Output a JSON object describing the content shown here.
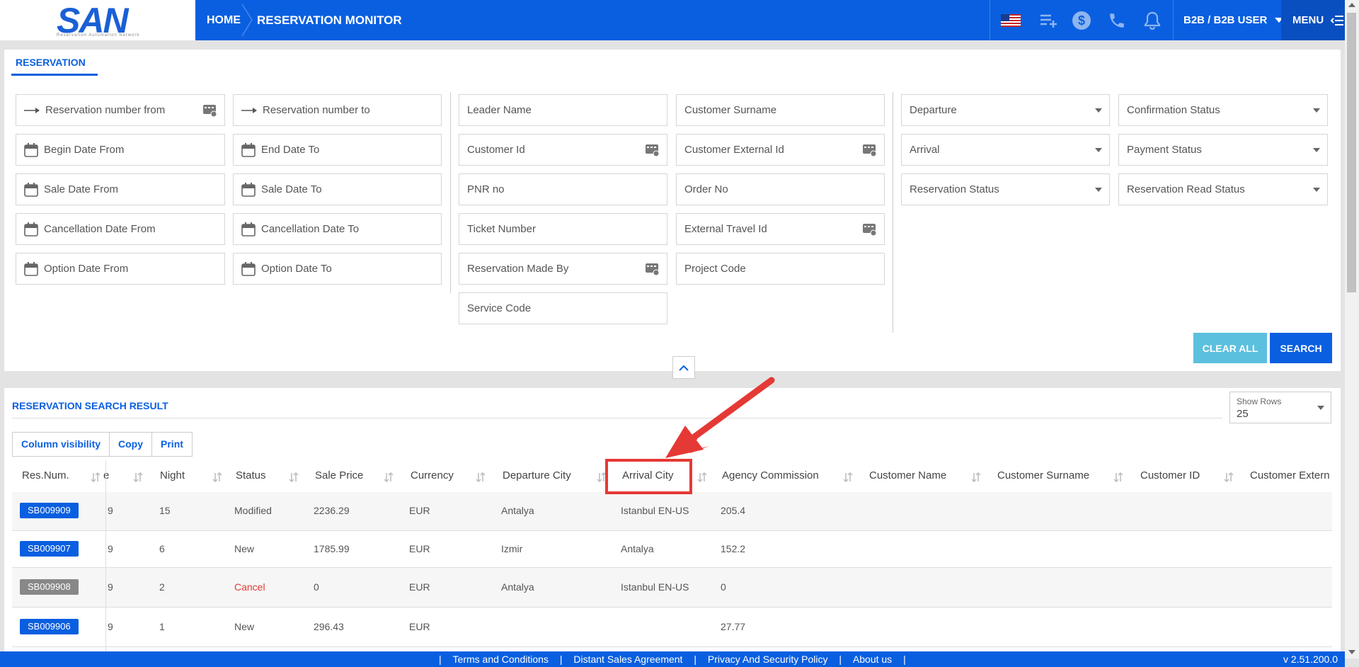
{
  "header": {
    "logo": "SAN",
    "logo_sub": "Reservation Automation Network",
    "home": "HOME",
    "title": "RESERVATION MONITOR",
    "user": "B2B / B2B USER",
    "menu": "MENU"
  },
  "filters": {
    "tab": "RESERVATION",
    "col1": [
      "Reservation number from",
      "Begin Date From",
      "Sale Date From",
      "Cancellation Date From",
      "Option Date From"
    ],
    "col2": [
      "Reservation number to",
      "End Date To",
      "Sale Date To",
      "Cancellation Date To",
      "Option Date To"
    ],
    "col3": [
      "Leader Name",
      "Customer Id",
      "PNR no",
      "Ticket Number",
      "Reservation Made By",
      "Service Code"
    ],
    "col4": [
      "Customer Surname",
      "Customer External Id",
      "Order No",
      "External Travel Id",
      "Project Code"
    ],
    "col5": [
      "Departure",
      "Arrival",
      "Reservation Status"
    ],
    "col6": [
      "Confirmation Status",
      "Payment Status",
      "Reservation Read Status"
    ],
    "clear_all": "CLEAR ALL",
    "search": "SEARCH"
  },
  "results": {
    "title": "RESERVATION SEARCH RESULT",
    "show_rows_label": "Show Rows",
    "show_rows_value": "25",
    "buttons": [
      "Column visibility",
      "Copy",
      "Print"
    ],
    "columns": [
      "Res.Num.",
      "e",
      "Night",
      "Status",
      "Sale Price",
      "Currency",
      "Departure City",
      "Arrival City",
      "Agency Commission",
      "Customer Name",
      "Customer Surname",
      "Customer ID",
      "Customer Extern"
    ],
    "rows": [
      {
        "resnum": "SB009909",
        "e": "9",
        "night": "15",
        "status": "Modified",
        "price": "2236.29",
        "currency": "EUR",
        "dep": "Antalya",
        "arr": "Istanbul EN-US",
        "comm": "205.4"
      },
      {
        "resnum": "SB009907",
        "e": "9",
        "night": "6",
        "status": "New",
        "price": "1785.99",
        "currency": "EUR",
        "dep": "Izmir",
        "arr": "Antalya",
        "comm": "152.2"
      },
      {
        "resnum": "SB009908",
        "e": "9",
        "night": "2",
        "status": "Cancel",
        "price": "0",
        "currency": "EUR",
        "dep": "Antalya",
        "arr": "Istanbul EN-US",
        "comm": "0"
      },
      {
        "resnum": "SB009906",
        "e": "9",
        "night": "1",
        "status": "New",
        "price": "296.43",
        "currency": "EUR",
        "dep": "",
        "arr": "",
        "comm": "27.77"
      }
    ]
  },
  "footer": {
    "links": [
      "Terms and Conditions",
      "Distant Sales Agreement",
      "Privacy And Security Policy",
      "About us"
    ],
    "version": "v 2.51.200.0"
  },
  "colors": {
    "primary": "#0a5fe0",
    "info": "#5bc0de",
    "cancel": "#e53935",
    "annotation": "#e53935"
  }
}
